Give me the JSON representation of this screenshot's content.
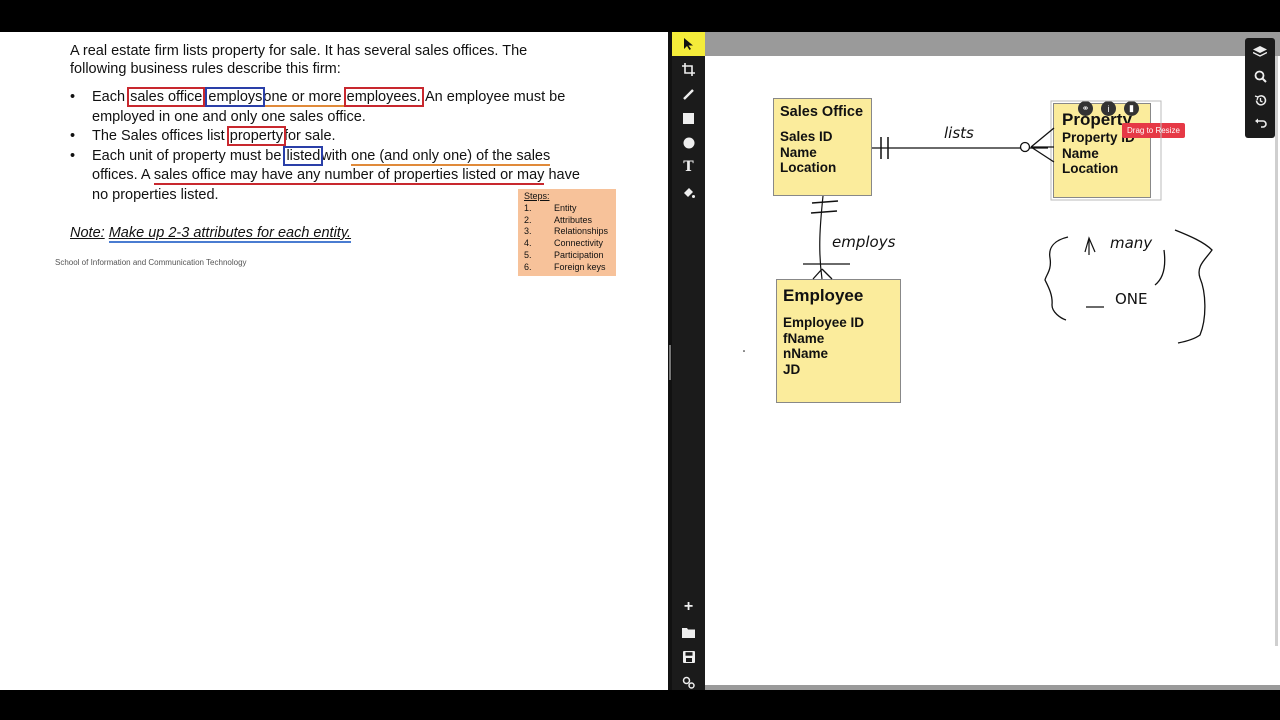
{
  "document": {
    "intro": "A real estate firm lists property for sale. It has several sales offices. The following business rules describe this firm:",
    "b1": {
      "t1": "Each ",
      "sales_office": "sales office",
      "employs": "employs",
      "t2": "one or more ",
      "employees": "employees.",
      "t3": " An employee must be employed in one and only one sales office."
    },
    "b2": {
      "t1": "The Sales offices list ",
      "property": "property",
      "t2": "for sale."
    },
    "b3": {
      "t1": "Each unit of property must be ",
      "listed": "listed",
      "t2": "with ",
      "t3": "one (and only one) of the sales",
      "t4": " offices. A ",
      "t5": "sales office may have any number of properties listed or may",
      "t6": " have no properties listed."
    },
    "note_label": "Note:",
    "note_text": "Make up 2-3 attributes for each entity.",
    "footer": "School of Information and Communication Technology",
    "steps": {
      "title": "Steps:",
      "items": [
        {
          "num": "1.",
          "label": "Entity"
        },
        {
          "num": "2.",
          "label": "Attributes"
        },
        {
          "num": "3.",
          "label": "Relationships"
        },
        {
          "num": "4.",
          "label": "Connectivity"
        },
        {
          "num": "5.",
          "label": "Participation"
        },
        {
          "num": "6.",
          "label": "Foreign keys"
        }
      ]
    }
  },
  "toolbar": {
    "top": [
      "select-arrow-icon",
      "crop-icon",
      "pen-icon",
      "square-icon",
      "circle-icon",
      "text-icon",
      "fill-icon"
    ],
    "bottom": [
      "plus-icon",
      "folder-icon",
      "save-icon",
      "settings-icon"
    ]
  },
  "right_tools": [
    "layers-icon",
    "search-icon",
    "history-icon",
    "undo-icon"
  ],
  "diagram": {
    "sales_office": {
      "title": "Sales Office",
      "attrs": [
        "Sales ID",
        "Name",
        "Location"
      ]
    },
    "property": {
      "title": "Property",
      "attrs": [
        "Property ID",
        "Name",
        "Location"
      ]
    },
    "employee": {
      "title": "Employee",
      "attrs": [
        "Employee ID",
        "fName",
        "nName",
        "JD"
      ]
    },
    "label_lists": "lists",
    "label_employs": "employs",
    "label_many": "many",
    "label_one": "ONE",
    "drag_tip": "Drag to Resize"
  }
}
